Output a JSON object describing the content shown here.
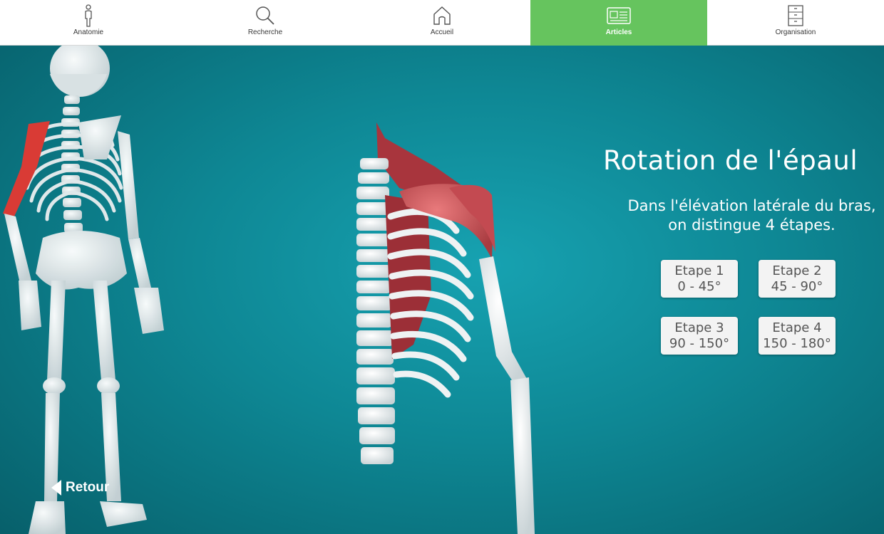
{
  "tabs": [
    {
      "label": "Anatomie",
      "icon": "person-icon",
      "active": false
    },
    {
      "label": "Recherche",
      "icon": "search-icon",
      "active": false
    },
    {
      "label": "Accueil",
      "icon": "home-icon",
      "active": false
    },
    {
      "label": "Articles",
      "icon": "newspaper-icon",
      "active": true
    },
    {
      "label": "Organisation",
      "icon": "cabinet-icon",
      "active": false
    }
  ],
  "article": {
    "title": "Rotation de l'épaul",
    "subtitle": "Dans l'élévation latérale du bras, on distingue 4 étapes.",
    "steps": [
      {
        "label": "Etape 1",
        "range": "0 - 45°"
      },
      {
        "label": "Etape 2",
        "range": "45 - 90°"
      },
      {
        "label": "Etape 3",
        "range": "90 - 150°"
      },
      {
        "label": "Etape 4",
        "range": "150 - 180°"
      }
    ]
  },
  "back_label": "Retour",
  "colors": {
    "active_tab": "#66c45e",
    "background": "#0f8e9c",
    "muscle": "#d25a5e",
    "bone": "#eef0f1",
    "highlight_bone": "#e23b33"
  }
}
